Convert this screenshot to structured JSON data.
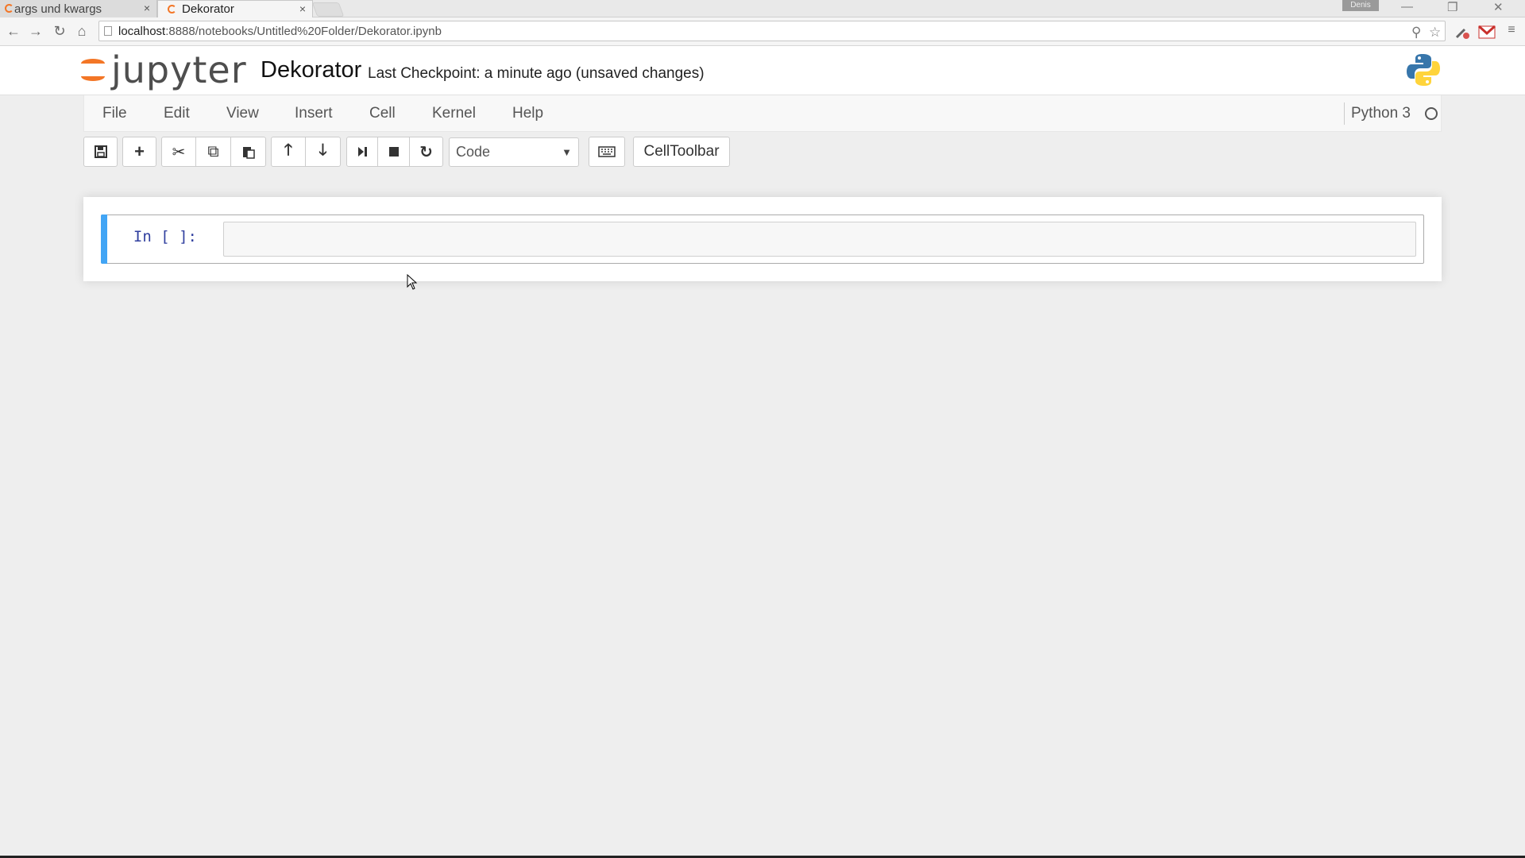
{
  "browser": {
    "tabs": [
      {
        "title": "args und kwargs",
        "active": false
      },
      {
        "title": "Dekorator",
        "active": true
      }
    ],
    "tab_close_glyph": "×",
    "user_badge": "Denis",
    "url_host": "localhost",
    "url_rest": ":8888/notebooks/Untitled%20Folder/Dekorator.ipynb",
    "icons": [
      "back-arrow-icon",
      "forward-arrow-icon",
      "reload-icon",
      "home-icon",
      "page-icon",
      "zoom-icon",
      "star-icon",
      "extension-icon",
      "gmail-icon",
      "chrome-menu-icon"
    ]
  },
  "jupyter": {
    "logo_text": "jupyter",
    "notebook_name": "Dekorator",
    "checkpoint": "Last Checkpoint: a minute ago (unsaved changes)",
    "kernel_name": "Python 3",
    "brand_color": "#f37626"
  },
  "menu": {
    "items": [
      "File",
      "Edit",
      "View",
      "Insert",
      "Cell",
      "Kernel",
      "Help"
    ]
  },
  "toolbar": {
    "icons": [
      "save-icon",
      "add-cell-icon",
      "cut-icon",
      "copy-icon",
      "paste-icon",
      "move-up-icon",
      "move-down-icon",
      "run-icon",
      "interrupt-icon",
      "restart-icon",
      "keyboard-icon"
    ],
    "cell_type": "Code",
    "celltoolbar_label": "CellToolbar"
  },
  "cell": {
    "prompt": "In [ ]:",
    "input": "",
    "selected_color": "#42a5f5"
  }
}
